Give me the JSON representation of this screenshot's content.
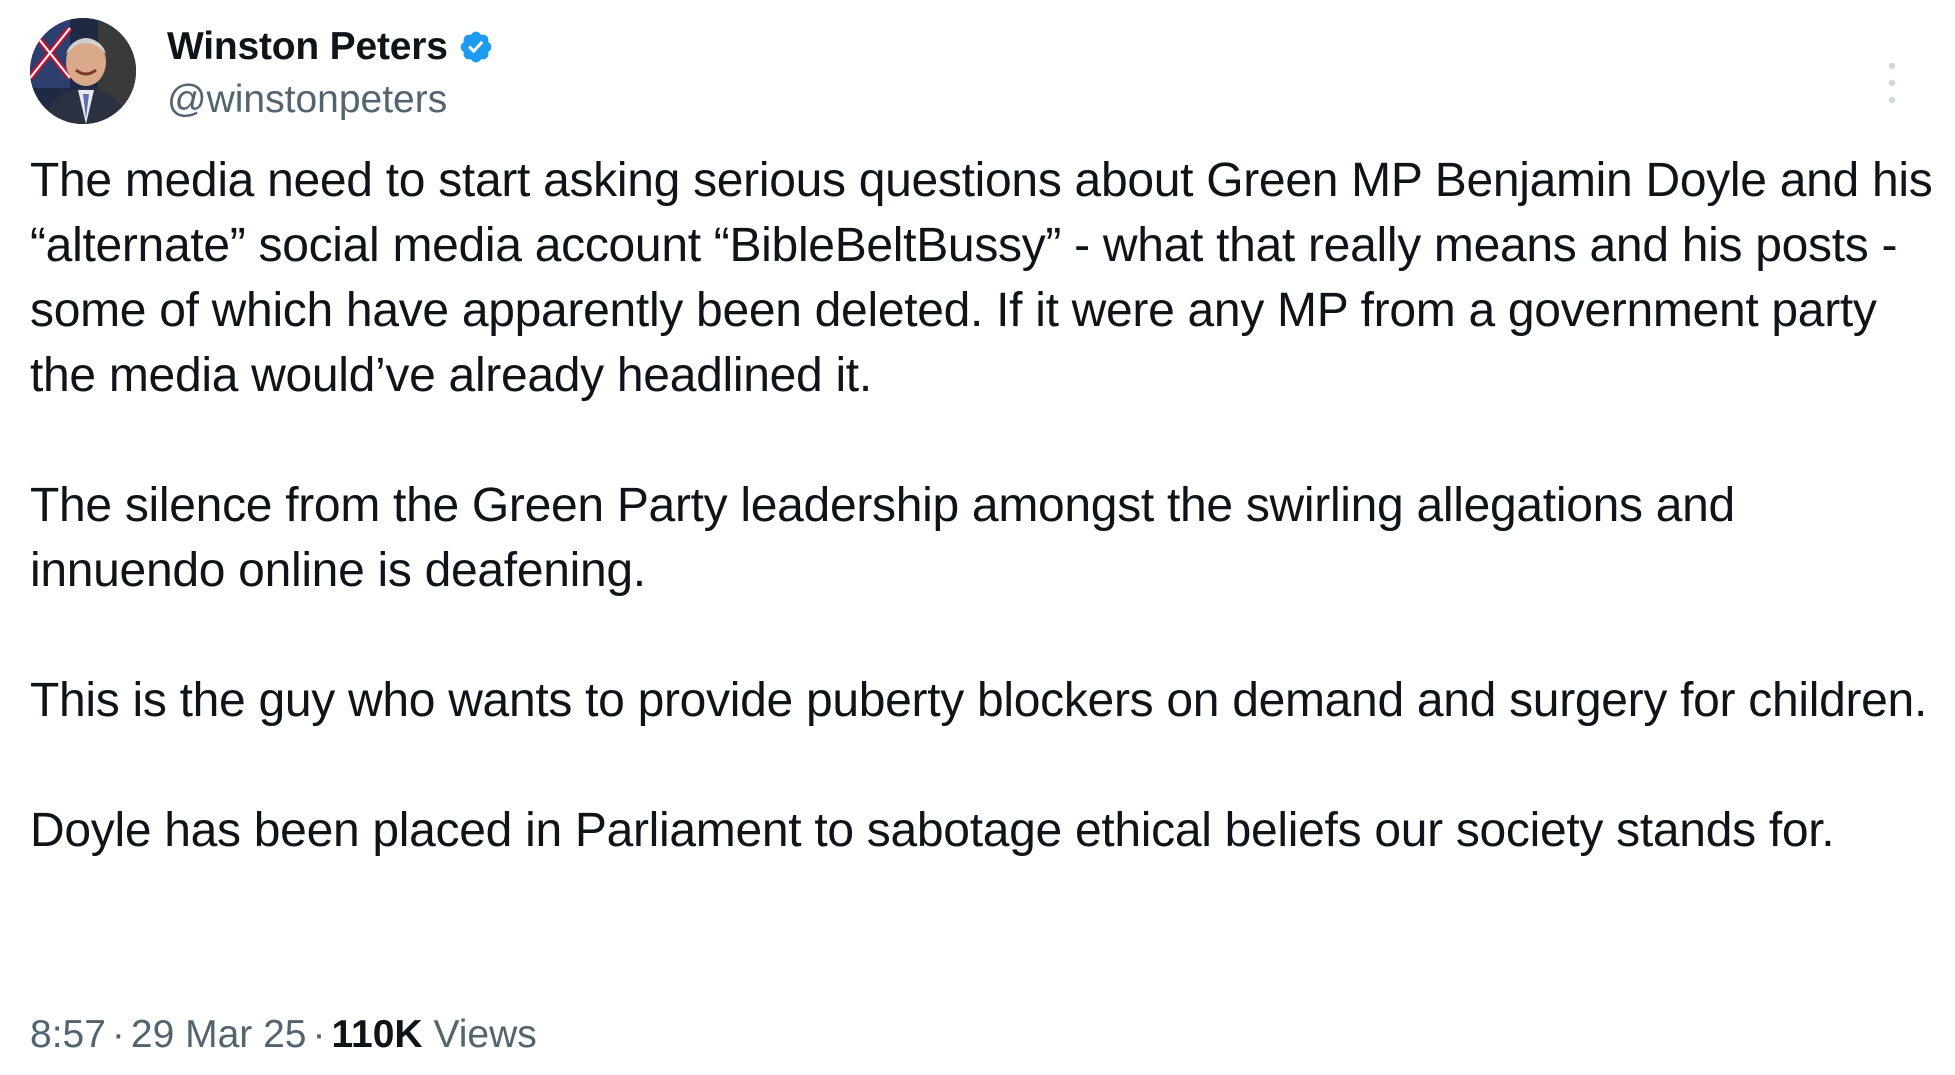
{
  "author": {
    "display_name": "Winston Peters",
    "handle": "@winstonpeters",
    "verified": true,
    "verified_color": "#1d9bf0"
  },
  "tweet": {
    "paragraphs": [
      "The media need to start asking serious questions about Green MP Benjamin Doyle and his “alternate” social media account “BibleBeltBussy” - what that really means and his posts - some of which have apparently been deleted. If it were any MP from a government party the media would’ve already headlined it.",
      "The silence from the Green Party leadership amongst the swirling allegations and innuendo online is deafening.",
      "This is the guy who wants to provide puberty blockers on demand and surgery for children.",
      "Doyle has been placed in Parliament to sabotage ethical beliefs our society stands for."
    ]
  },
  "meta": {
    "time": "8:57",
    "date": "29 Mar 25",
    "separator": "·",
    "views_count": "110K",
    "views_label": "Views"
  },
  "colors": {
    "text_primary": "#0f1419",
    "text_secondary": "#536471",
    "background": "#ffffff"
  },
  "icons": {
    "verified": "verified-badge-icon",
    "more": "more-vertical-icon"
  }
}
